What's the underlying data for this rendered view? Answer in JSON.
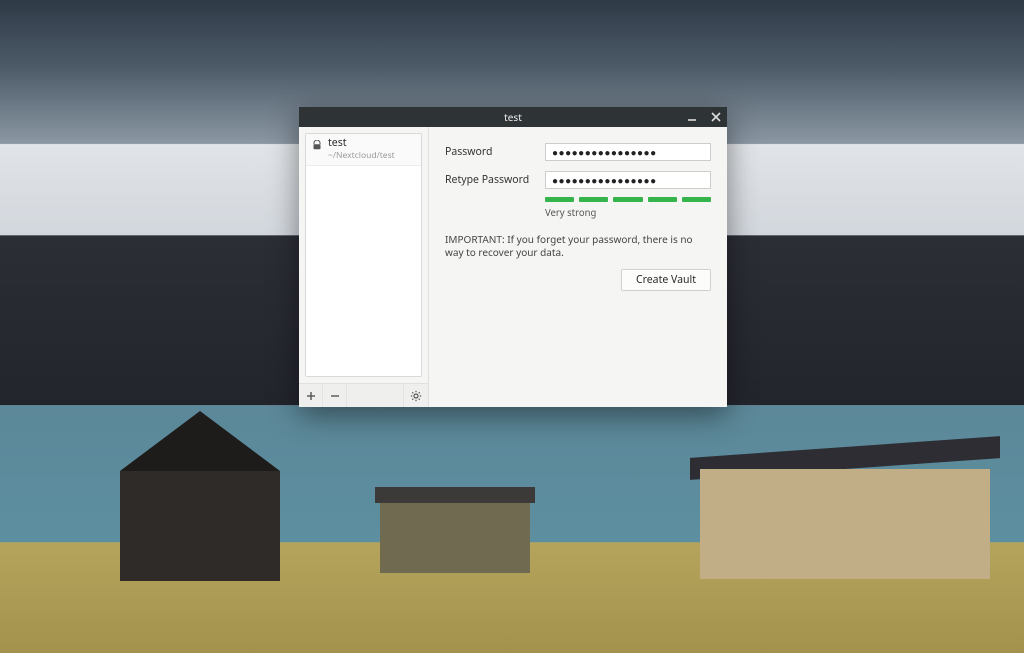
{
  "window": {
    "title": "test"
  },
  "sidebar": {
    "vaults": [
      {
        "name": "test",
        "path": "~/Nextcloud/test"
      }
    ]
  },
  "form": {
    "password_label": "Password",
    "retype_label": "Retype Password",
    "password_display": "●●●●●●●●●●●●●●●●",
    "retype_display": "●●●●●●●●●●●●●●●●",
    "strength_label": "Very strong",
    "strength_segments": 5,
    "warning": "IMPORTANT: If you forget your password, there is no way to recover your data.",
    "create_label": "Create Vault"
  }
}
